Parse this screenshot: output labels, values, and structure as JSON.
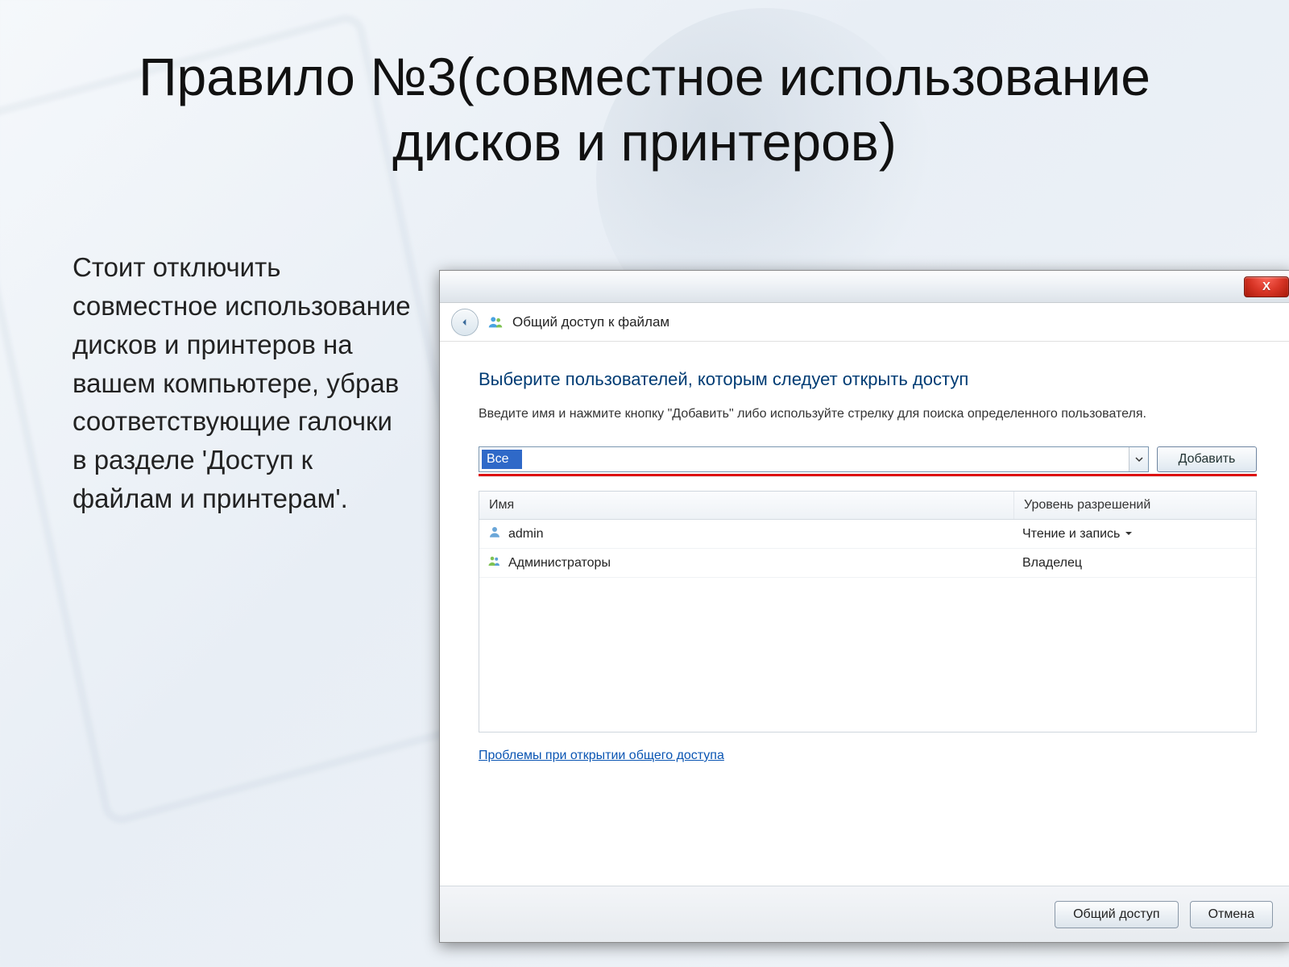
{
  "slide": {
    "title": "Правило №3(совместное использование дисков и принтеров)",
    "body": "Стоит отключить совместное использование дисков и принтеров на вашем компьютере, убрав соответствующие галочки в разделе 'Доступ к файлам и принтерам'."
  },
  "dialog": {
    "close_label": "X",
    "nav_title": "Общий доступ к файлам",
    "heading": "Выберите пользователей, которым следует открыть доступ",
    "subtext": "Введите имя и нажмите кнопку \"Добавить\" либо используйте стрелку для поиска определенного пользователя.",
    "combo_value": "Все",
    "add_button": "Добавить",
    "columns": {
      "name": "Имя",
      "permission": "Уровень разрешений"
    },
    "rows": [
      {
        "name": "admin",
        "permission": "Чтение и запись",
        "has_dropdown": true,
        "icon": "user"
      },
      {
        "name": "Администраторы",
        "permission": "Владелец",
        "has_dropdown": false,
        "icon": "group"
      }
    ],
    "help_link": "Проблемы при открытии общего доступа",
    "footer": {
      "share": "Общий доступ",
      "cancel": "Отмена"
    }
  }
}
